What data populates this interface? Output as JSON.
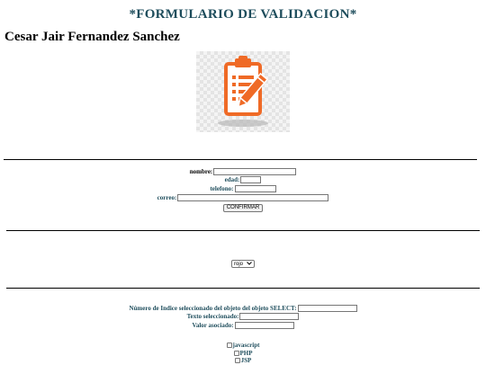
{
  "page": {
    "title": "*FORMULARIO DE VALIDACION*",
    "author": "Cesar Jair Fernandez Sanchez"
  },
  "logo": {
    "icon": "clipboard-pencil-icon",
    "accent": "#ef6a26"
  },
  "form": {
    "nombre_label": "nombre:",
    "edad_label": "edad:",
    "telefono_label": "telefono:",
    "correo_label": "correo:",
    "nombre_value": "",
    "edad_value": "",
    "telefono_value": "",
    "correo_value": "",
    "confirm_label": "CONFIRMAR"
  },
  "color_select": {
    "selected": "rojo"
  },
  "select_info": {
    "index_label": "Número de Indice seleccionado del objeto del objeto SELECT:",
    "text_label": "Texto seleccionado:",
    "value_label": "Valor asociado:",
    "index_value": "",
    "text_value": "",
    "value_value": ""
  },
  "checkboxes": [
    {
      "label": "javascript",
      "checked": false
    },
    {
      "label": "PHP",
      "checked": false
    },
    {
      "label": "JSP",
      "checked": false
    }
  ],
  "colors": {
    "heading": "#1e4d5c",
    "accent": "#ef6a26"
  }
}
